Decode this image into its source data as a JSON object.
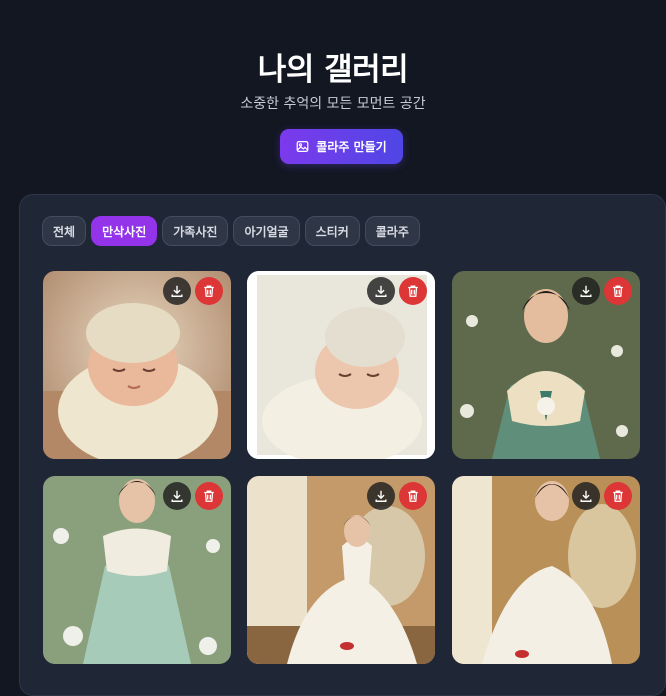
{
  "header": {
    "title": "나의 갤러리",
    "subtitle": "소중한 추억의 모든 모먼트 공간",
    "collage_button": "콜라주 만들기"
  },
  "tabs": [
    {
      "label": "전체",
      "active": false
    },
    {
      "label": "만삭사진",
      "active": true
    },
    {
      "label": "가족사진",
      "active": false
    },
    {
      "label": "아기얼굴",
      "active": false
    },
    {
      "label": "스티커",
      "active": false
    },
    {
      "label": "콜라주",
      "active": false
    }
  ],
  "photos": [
    {
      "subject": "newborn in knit hat",
      "actions": [
        "download-icon",
        "trash-icon"
      ]
    },
    {
      "subject": "newborn sleeping",
      "actions": [
        "download-icon",
        "trash-icon"
      ]
    },
    {
      "subject": "woman in hanbok",
      "actions": [
        "download-icon",
        "trash-icon"
      ]
    },
    {
      "subject": "pregnant woman in hanbok",
      "actions": [
        "download-icon",
        "trash-icon"
      ]
    },
    {
      "subject": "woman in white gown",
      "actions": [
        "download-icon",
        "trash-icon"
      ]
    },
    {
      "subject": "pregnant woman in white gown",
      "actions": [
        "download-icon",
        "trash-icon"
      ]
    }
  ],
  "colors": {
    "background": "#131722",
    "panel": "#1f2636",
    "accent": "#9333ea",
    "delete": "#dc3636"
  }
}
